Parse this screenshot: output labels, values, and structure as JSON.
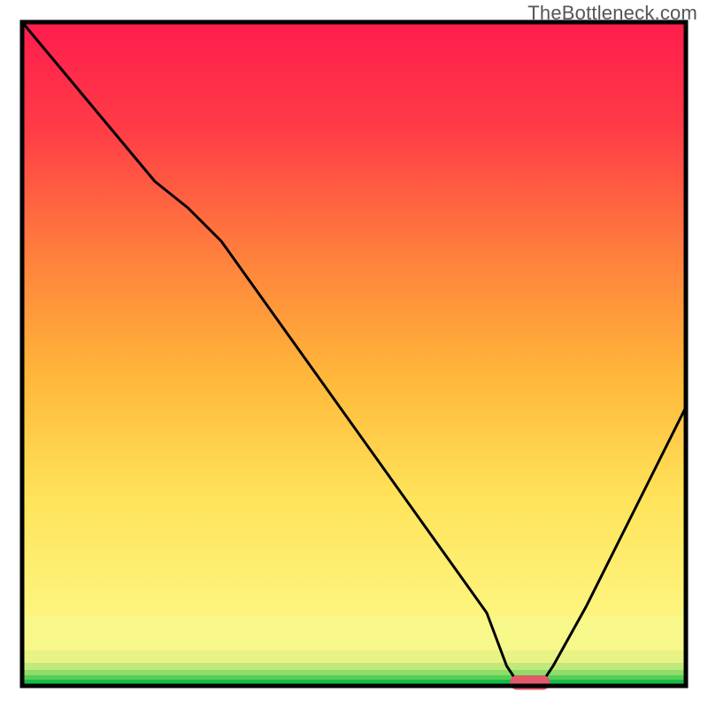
{
  "watermark": "TheBottleneck.com",
  "chart_data": {
    "type": "line",
    "title": "",
    "xlabel": "",
    "ylabel": "",
    "xlim": [
      0,
      100
    ],
    "ylim": [
      0,
      100
    ],
    "x": [
      0,
      5,
      10,
      15,
      20,
      25,
      30,
      35,
      40,
      45,
      50,
      55,
      60,
      65,
      70,
      73,
      75,
      78,
      80,
      85,
      90,
      95,
      100
    ],
    "y": [
      100,
      94,
      88,
      82,
      76,
      72,
      67,
      60,
      53,
      46,
      39,
      32,
      25,
      18,
      11,
      3,
      0,
      0,
      3,
      12,
      22,
      32,
      42
    ],
    "background_bands": [
      {
        "from_y": 0.0,
        "to_y": 0.025,
        "color": "#17bb48"
      },
      {
        "from_y": 0.025,
        "to_y": 0.05,
        "color": "#6bd65e"
      },
      {
        "from_y": 0.05,
        "to_y": 0.08,
        "color": "#d1ee80"
      },
      {
        "from_y": 0.08,
        "to_y": 0.15,
        "color": "#f7f78a"
      },
      {
        "from_y": 0.15,
        "to_y": 0.33,
        "color_top": "#ffd93e",
        "color_bottom": "#fff07a"
      },
      {
        "from_y": 0.33,
        "to_y": 0.6,
        "color_top": "#ff963a",
        "color_bottom": "#ffd93e"
      },
      {
        "from_y": 0.6,
        "to_y": 0.82,
        "color_top": "#ff5240",
        "color_bottom": "#ff963a"
      },
      {
        "from_y": 0.82,
        "to_y": 1.0,
        "color_top": "#ff1c4d",
        "color_bottom": "#ff5240"
      }
    ],
    "marker": {
      "x_center": 76.5,
      "y": 0.5,
      "width": 6,
      "height": 2.2,
      "color": "#e05a6a"
    },
    "frame_color": "#000000",
    "line_color": "#000000"
  }
}
